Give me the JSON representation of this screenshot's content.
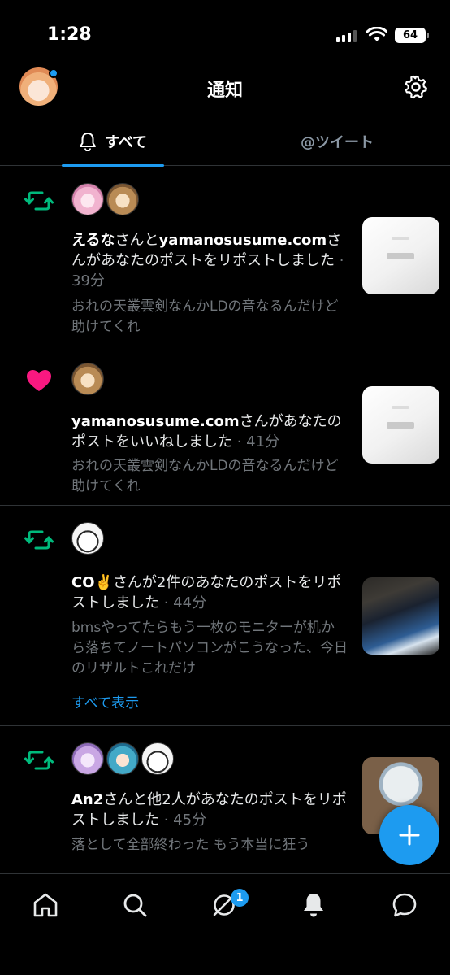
{
  "status": {
    "time": "1:28",
    "battery": "64"
  },
  "header": {
    "title": "通知"
  },
  "tabs": {
    "all": "すべて",
    "mentions": "@ツイート"
  },
  "notifications": [
    {
      "kind": "retweet",
      "actor1": "えるな",
      "joiner": "さんと",
      "actor2": "yamanosusume.com",
      "action": "さんがあなたのポストをリポストしました",
      "ago": "39分",
      "excerpt": "おれの天叢雲剣なんかLDの音なるんだけど 助けてくれ"
    },
    {
      "kind": "like",
      "actor1": "yamanosusume.com",
      "action": "さんがあなたのポストをいいねしました",
      "ago": "41分",
      "excerpt": "おれの天叢雲剣なんかLDの音なるんだけど 助けてくれ"
    },
    {
      "kind": "retweet",
      "actor1": "CO✌️",
      "action": "さんが2件のあなたのポストをリポストしました",
      "ago": "44分",
      "excerpt": "bmsやってたらもう一枚のモニターが机から落ちてノートパソコンがこうなった、今日のリザルトこれだけ",
      "show_all": "すべて表示"
    },
    {
      "kind": "retweet",
      "actor1": "An2",
      "action": "さんと他2人があなたのポストをリポストしました",
      "ago": "45分",
      "excerpt": "落として全部終わった もう本当に狂う"
    }
  ],
  "nav": {
    "dm_badge": "1"
  },
  "colors": {
    "accent": "#1d9bf0",
    "retweet": "#00ba7c",
    "like": "#f91880"
  }
}
